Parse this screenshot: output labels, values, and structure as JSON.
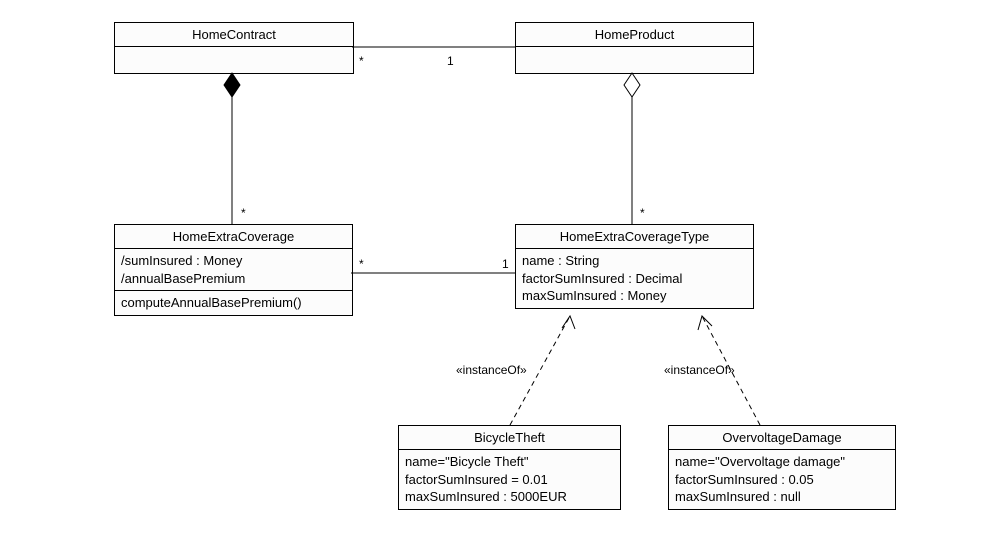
{
  "classes": {
    "homeContract": {
      "name": "HomeContract"
    },
    "homeProduct": {
      "name": "HomeProduct"
    },
    "homeExtraCoverage": {
      "name": "HomeExtraCoverage",
      "attr1": "/sumInsured : Money",
      "attr2": "/annualBasePremium",
      "op1": "computeAnnualBasePremium()"
    },
    "homeExtraCoverageType": {
      "name": "HomeExtraCoverageType",
      "attr1": "name : String",
      "attr2": "factorSumInsured : Decimal",
      "attr3": "maxSumInsured : Money"
    },
    "bicycleTheft": {
      "name": "BicycleTheft",
      "attr1": "name=\"Bicycle Theft\"",
      "attr2": "factorSumInsured = 0.01",
      "attr3": "maxSumInsured : 5000EUR"
    },
    "overvoltageDamage": {
      "name": "OvervoltageDamage",
      "attr1": "name=\"Overvoltage damage\"",
      "attr2": "factorSumInsured : 0.05",
      "attr3": "maxSumInsured : null"
    }
  },
  "assoc": {
    "contract_product": {
      "left": "*",
      "right": "1"
    },
    "coverage_type": {
      "left": "*",
      "right": "1"
    },
    "contract_coverage": {
      "end": "*"
    },
    "product_type": {
      "end": "*"
    }
  },
  "stereo": {
    "instanceOf1": "«instanceOf»",
    "instanceOf2": "«instanceOf»"
  }
}
